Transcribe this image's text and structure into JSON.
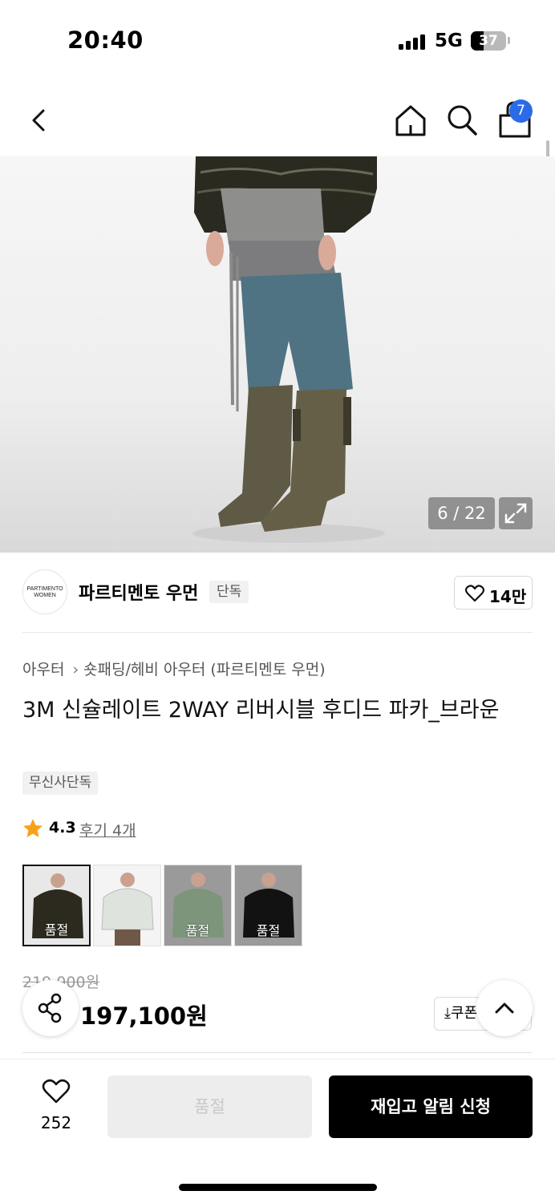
{
  "status": {
    "time": "20:40",
    "network": "5G",
    "battery": "37",
    "battery_level": 0.37
  },
  "nav": {
    "cart_count": "7"
  },
  "gallery": {
    "counter": "6 / 22"
  },
  "brand": {
    "logo_text_1": "PARTIMENTO",
    "logo_text_2": "WOMEN",
    "name": "파르티멘토 우먼",
    "tag": "단독",
    "likes": "14만"
  },
  "breadcrumb": {
    "category": "아우터",
    "subcategory": "숏패딩/헤비 아우터 (파르티멘토 우먼)"
  },
  "product": {
    "title": "3M 신슐레이트 2WAY 리버시블 후디드 파카_브라운",
    "exclusive_tag": "무신사단독",
    "rating": "4.3",
    "review_link": "후기 4개",
    "original_price": "219,000원",
    "sale_price": "197,100원",
    "coupon_label": "쿠폰"
  },
  "colors": [
    {
      "label": "품절",
      "swatch": "#2c2a1f"
    },
    {
      "label": "",
      "swatch": "#dfe3dd"
    },
    {
      "label": "품절",
      "swatch": "#7c957b"
    },
    {
      "label": "품절",
      "swatch": "#121212"
    }
  ],
  "bottom": {
    "wish_count": "252",
    "soldout_label": "품절",
    "restock_label": "재입고 알림 신청"
  },
  "accent": {
    "cart_badge": "#2b6be7",
    "rating_star": "#f7a21a"
  }
}
